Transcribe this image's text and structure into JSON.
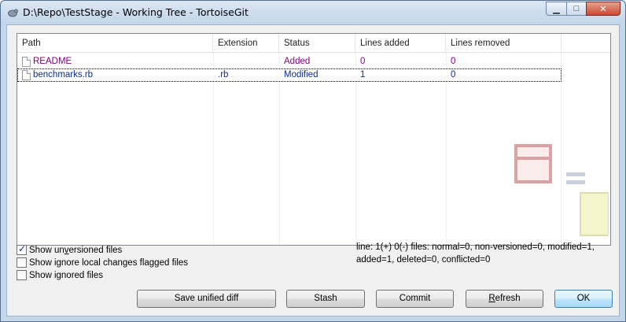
{
  "window": {
    "title": "D:\\Repo\\TestStage - Working Tree - TortoiseGit",
    "min_glyph": "▁",
    "max_glyph": "□",
    "close_glyph": "✕"
  },
  "table": {
    "columns": [
      "Path",
      "Extension",
      "Status",
      "Lines added",
      "Lines removed"
    ],
    "rows": [
      {
        "path": "README",
        "extension": "",
        "status": "Added",
        "lines_added": "0",
        "lines_removed": "0"
      },
      {
        "path": "benchmarks.rb",
        "extension": ".rb",
        "status": "Modified",
        "lines_added": "1",
        "lines_removed": "0"
      }
    ]
  },
  "options": {
    "show_unversioned": {
      "pre": "Show un",
      "accel": "v",
      "post": "ersioned files",
      "checked": true
    },
    "show_ignore_local": {
      "label": "Show ignore local changes flagged files",
      "checked": false
    },
    "show_ignored": {
      "label": "Show ignored files",
      "checked": false
    }
  },
  "status_line": {
    "line1": "line: 1(+) 0(-) files: normal=0, non-versioned=0, modified=1,",
    "line2": "added=1, deleted=0, conflicted=0"
  },
  "buttons": {
    "save_unified_diff": "Save unified diff",
    "stash": "Stash",
    "commit": "Commit",
    "refresh_accel": "R",
    "refresh_rest": "efresh",
    "ok": "OK"
  },
  "colors": {
    "added": "#800080",
    "modified": "#0b2d8c",
    "title_bar": "#c4d6ea",
    "close_button": "#c74a31"
  },
  "icons": {
    "app": "tortoisegit-icon",
    "file": "file-icon",
    "watermark": "diff-watermark-icon"
  }
}
